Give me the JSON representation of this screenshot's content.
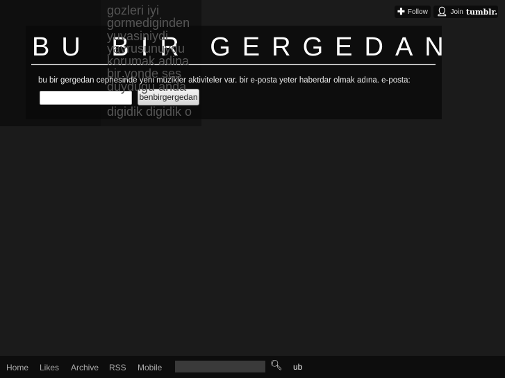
{
  "poem": [
    "gozleri iyi",
    "gormediginden",
    "yuvasiniydi",
    "yavrusunuydu",
    "korumak adina",
    "bir yonde ses",
    "duydugu anda",
    "",
    "digidik digidik o"
  ],
  "header": {
    "title": "BU BIR GERGEDAN",
    "description": "bu bir gergedan cephesinde yeni müzikler aktiviteler var. bir e-posta yeter haberdar olmak adına. e-posta:",
    "email_value": "",
    "submit_label": "benbirgergedan"
  },
  "tumblr": {
    "follow": "Follow",
    "join": "Join",
    "brand": "tumblr."
  },
  "footer": {
    "links": [
      "Home",
      "Likes",
      "Archive",
      "RSS",
      "Mobile"
    ],
    "search_value": "",
    "ub": "ub"
  }
}
